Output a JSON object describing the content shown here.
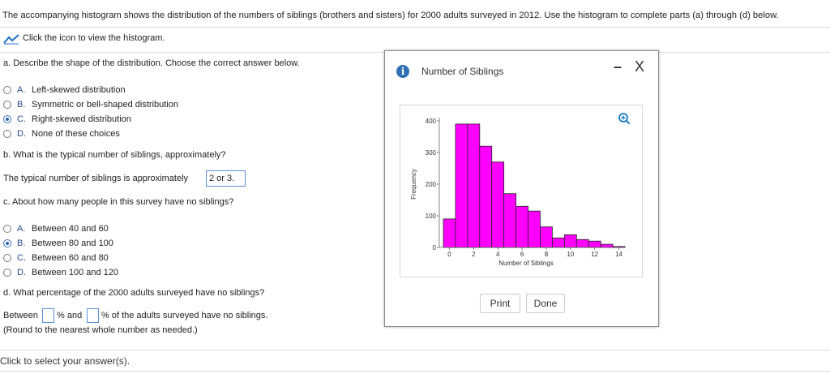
{
  "header": {
    "question": "The accompanying histogram shows the distribution of the numbers of siblings (brothers and sisters) for 2000 adults surveyed in 2012. Use the histogram to complete parts (a) through (d) below.",
    "link_text": "Click the icon to view the histogram."
  },
  "part_a": {
    "prompt": "a. Describe the shape of the distribution. Choose the correct answer below.",
    "options": [
      {
        "letter": "A.",
        "text": "Left-skewed distribution",
        "selected": false
      },
      {
        "letter": "B.",
        "text": "Symmetric or bell-shaped distribution",
        "selected": false
      },
      {
        "letter": "C.",
        "text": "Right-skewed distribution",
        "selected": true
      },
      {
        "letter": "D.",
        "text": "None of these choices",
        "selected": false
      }
    ]
  },
  "part_b": {
    "prompt": "b. What is the typical number of siblings, approximately?",
    "answer_prefix": "The typical number of siblings is approximately",
    "answer_value": "2 or 3."
  },
  "part_c": {
    "prompt": "c. About how many people in this survey have no siblings?",
    "options": [
      {
        "letter": "A.",
        "text": "Between 40 and 60",
        "selected": false
      },
      {
        "letter": "B.",
        "text": "Between 80 and 100",
        "selected": true
      },
      {
        "letter": "C.",
        "text": "Between 60 and 80",
        "selected": false
      },
      {
        "letter": "D.",
        "text": "Between 100 and 120",
        "selected": false
      }
    ]
  },
  "part_d": {
    "prompt": "d. What percentage of the 2000 adults surveyed have no siblings?",
    "between": "Between",
    "pct_and": "% and",
    "pct_tail": "% of the adults surveyed have no siblings.",
    "round_note": "(Round to the nearest whole number as needed.)"
  },
  "footer": {
    "status": "Click to select your answer(s)."
  },
  "dialog": {
    "title": "Number of Siblings",
    "minimize_glyph": "–",
    "close_glyph": "X",
    "print_label": "Print",
    "done_label": "Done"
  },
  "colors": {
    "bar_fill": "#ff00ff",
    "info_icon": "#2f6fb3",
    "link_icon": "#1f6fc4"
  },
  "chart_data": {
    "type": "bar",
    "xlabel": "Number of Siblings",
    "ylabel": "Frequency",
    "x_ticks": [
      0,
      2,
      4,
      6,
      8,
      10,
      12,
      14
    ],
    "y_ticks": [
      0,
      100,
      200,
      300,
      400
    ],
    "ylim": [
      0,
      400
    ],
    "xlim": [
      -0.5,
      14.5
    ],
    "bin_starts": [
      -0.5,
      0.5,
      1.5,
      2.5,
      3.5,
      4.5,
      5.5,
      6.5,
      7.5,
      8.5,
      9.5,
      10.5,
      11.5,
      12.5,
      13.5
    ],
    "values": [
      90,
      390,
      390,
      320,
      270,
      170,
      130,
      115,
      65,
      30,
      40,
      25,
      20,
      10,
      3
    ]
  }
}
